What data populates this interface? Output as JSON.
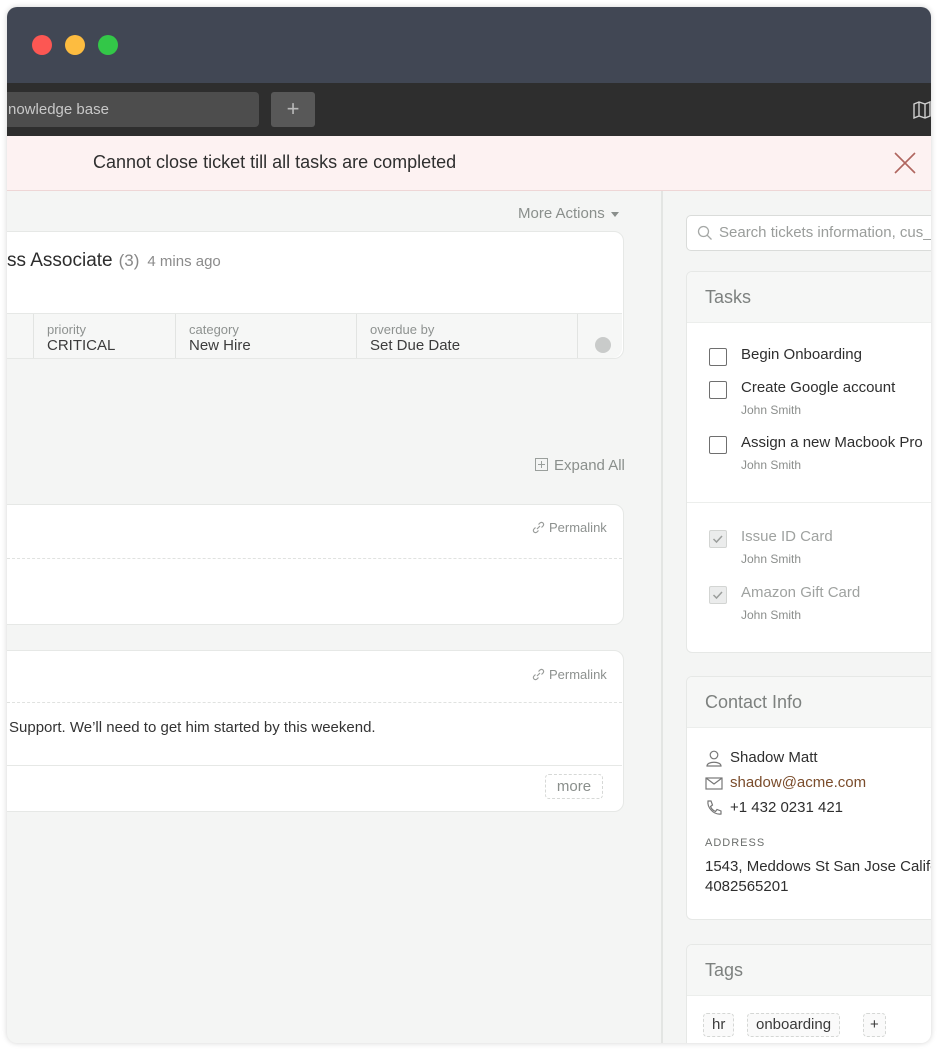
{
  "window": {
    "title": ""
  },
  "toolbar": {
    "search_value": "nowledge base",
    "add_label": "+"
  },
  "alert": {
    "message": "Cannot close ticket till all tasks are completed"
  },
  "ticket": {
    "more_actions": "More Actions",
    "title": "ss Associate",
    "count": "(3)",
    "time": "4 mins ago",
    "properties": [
      {
        "label": "priority",
        "value": "CRITICAL"
      },
      {
        "label": "category",
        "value": "New Hire"
      },
      {
        "label": "overdue by",
        "value": "Set Due Date"
      }
    ],
    "expand_all": "Expand All"
  },
  "messages": [
    {
      "permalink": "Permalink",
      "text": ""
    },
    {
      "permalink": "Permalink",
      "text": "Support. We’ll need to get him started by this weekend.",
      "more": "more"
    }
  ],
  "sidebar": {
    "search_placeholder": "Search tickets information, cus_",
    "tasks": {
      "heading": "Tasks",
      "open": [
        {
          "title": "Begin Onboarding",
          "assignee": ""
        },
        {
          "title": "Create Google account",
          "assignee": "John Smith"
        },
        {
          "title": "Assign a new Macbook Pro",
          "assignee": "John Smith"
        }
      ],
      "done": [
        {
          "title": "Issue ID Card",
          "assignee": "John Smith"
        },
        {
          "title": "Amazon Gift Card",
          "assignee": "John Smith"
        }
      ]
    },
    "contact": {
      "heading": "Contact Info",
      "name": "Shadow Matt",
      "email": "shadow@acme.com",
      "phone": "+1 432 0231 421",
      "address_label": "ADDRESS",
      "address_line1": "1543, Meddows St San Jose Califo",
      "address_line2": "4082565201"
    },
    "tags": {
      "heading": "Tags",
      "items": [
        "hr",
        "onboarding"
      ],
      "add_label": "+"
    }
  },
  "colors": {
    "alert_bg": "#fdf2f2",
    "titlebar": "#414754",
    "toolbar": "#2e2e2e",
    "email_link": "#7a4c2b"
  }
}
